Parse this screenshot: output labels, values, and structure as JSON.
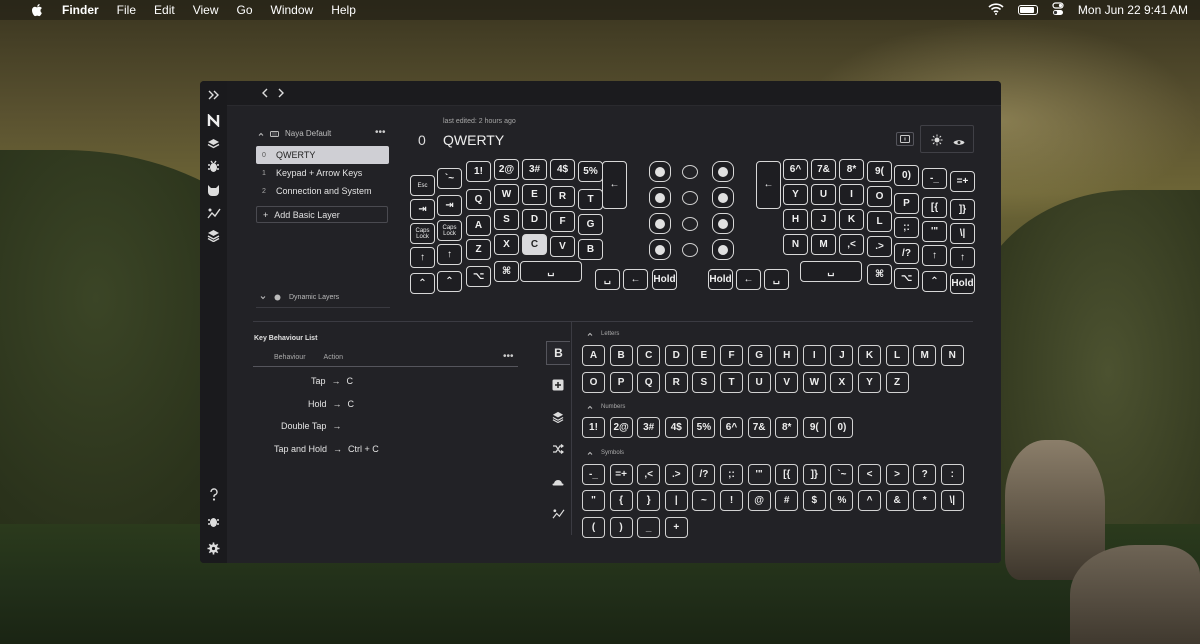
{
  "menubar": {
    "app": "Finder",
    "items": [
      "File",
      "Edit",
      "View",
      "Go",
      "Window",
      "Help"
    ],
    "datetime": "Mon Jun 22  9:41 AM"
  },
  "layers": {
    "group_name": "Naya Default",
    "list": [
      {
        "index": "0",
        "name": "QWERTY"
      },
      {
        "index": "1",
        "name": "Keypad + Arrow Keys"
      },
      {
        "index": "2",
        "name": "Connection and System"
      }
    ],
    "add_label": "Add Basic Layer",
    "dynamic_label": "Dynamic Layers"
  },
  "editor": {
    "last_edited": "last edited: 2 hours ago",
    "layer_index": "0",
    "layer_name": "QWERTY"
  },
  "keyboard": {
    "left": [
      {
        "label": "Esc",
        "small": true
      },
      {
        "label": "`~"
      },
      {
        "label": "1!"
      },
      {
        "label": "2@"
      },
      {
        "label": "3#"
      },
      {
        "label": "4$"
      },
      {
        "label": "5%"
      },
      {
        "label": "←"
      },
      {
        "label": "⇥"
      },
      {
        "label": "⇥"
      },
      {
        "label": "Q"
      },
      {
        "label": "W"
      },
      {
        "label": "E"
      },
      {
        "label": "R"
      },
      {
        "label": "T"
      },
      {
        "label": "Caps Lock",
        "small": true
      },
      {
        "label": "Caps Lock",
        "small": true
      },
      {
        "label": "A"
      },
      {
        "label": "S"
      },
      {
        "label": "D"
      },
      {
        "label": "F"
      },
      {
        "label": "G"
      },
      {
        "label": "↑"
      },
      {
        "label": "↑"
      },
      {
        "label": "Z"
      },
      {
        "label": "X"
      },
      {
        "label": "C"
      },
      {
        "label": "V"
      },
      {
        "label": "B"
      },
      {
        "label": "⌃"
      },
      {
        "label": "⌃"
      },
      {
        "label": "⌥"
      },
      {
        "label": "⌘"
      },
      {
        "label": "␣"
      },
      {
        "label": "␣"
      },
      {
        "label": "←"
      },
      {
        "label": "Hold"
      }
    ],
    "right": [
      {
        "label": "6^"
      },
      {
        "label": "7&"
      },
      {
        "label": "8*"
      },
      {
        "label": "9("
      },
      {
        "label": "0)"
      },
      {
        "label": "-_"
      },
      {
        "label": "=+"
      },
      {
        "label": "←"
      },
      {
        "label": "Y"
      },
      {
        "label": "U"
      },
      {
        "label": "I"
      },
      {
        "label": "O"
      },
      {
        "label": "P"
      },
      {
        "label": "[{"
      },
      {
        "label": "]}"
      },
      {
        "label": "H"
      },
      {
        "label": "J"
      },
      {
        "label": "K"
      },
      {
        "label": "L"
      },
      {
        "label": ";:"
      },
      {
        "label": "'\""
      },
      {
        "label": "\\|"
      },
      {
        "label": "N"
      },
      {
        "label": "M"
      },
      {
        "label": ",<"
      },
      {
        "label": ".>"
      },
      {
        "label": "/?"
      },
      {
        "label": "↑"
      },
      {
        "label": "↑"
      },
      {
        "label": "␣"
      },
      {
        "label": "⌘"
      },
      {
        "label": "⌥"
      },
      {
        "label": "⌃"
      },
      {
        "label": "Hold"
      },
      {
        "label": "Hold"
      },
      {
        "label": "←"
      },
      {
        "label": "␣"
      }
    ]
  },
  "behaviour": {
    "title": "Key Behaviour List",
    "col_behaviour": "Behaviour",
    "col_action": "Action",
    "rows": [
      {
        "trigger": "Tap",
        "action": "C"
      },
      {
        "trigger": "Hold",
        "action": "C"
      },
      {
        "trigger": "Double Tap",
        "action": ""
      },
      {
        "trigger": "Tap and Hold",
        "action": "Ctrl + C"
      }
    ]
  },
  "palette": {
    "active_tab": "B",
    "letters_label": "Letters",
    "letters_row1": [
      "A",
      "B",
      "C",
      "D",
      "E",
      "F",
      "G",
      "H",
      "I",
      "J",
      "K",
      "L",
      "M",
      "N"
    ],
    "letters_row2": [
      "O",
      "P",
      "Q",
      "R",
      "S",
      "T",
      "U",
      "V",
      "W",
      "X",
      "Y",
      "Z"
    ],
    "numbers_label": "Numbers",
    "numbers": [
      "1!",
      "2@",
      "3#",
      "4$",
      "5%",
      "6^",
      "7&",
      "8*",
      "9(",
      "0)"
    ],
    "symbols_label": "Symbols",
    "symbols_row1": [
      "-_",
      "=+",
      ",<",
      ".>",
      "/?",
      ";:",
      "'\"",
      "[{",
      "]}",
      "`~",
      "<",
      ">",
      "?",
      ":"
    ],
    "symbols_row2": [
      "\"",
      "{",
      "}",
      "|",
      "~",
      "!",
      "@",
      "#",
      "$",
      "%",
      "^",
      "&",
      "*",
      "\\|"
    ],
    "symbols_row3": [
      "(",
      ")",
      "_",
      "+"
    ]
  },
  "icons": {
    "accent": "#d9d9dc"
  }
}
